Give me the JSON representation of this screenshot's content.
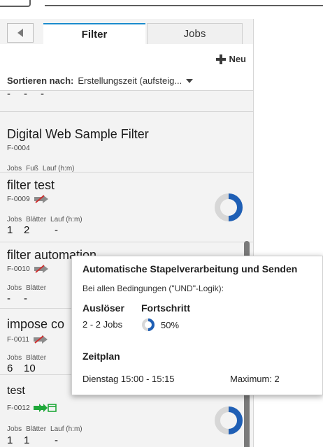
{
  "tabs": {
    "filter": "Filter",
    "jobs": "Jobs"
  },
  "toolbar": {
    "new_label": "Neu",
    "sort_label": "Sortieren nach:",
    "sort_value": "Erstellungszeit (aufsteig..."
  },
  "prev_card": {
    "values": [
      "-",
      "-",
      "-"
    ]
  },
  "cards": [
    {
      "title": "Digital Web Sample Filter",
      "id": "F-0004",
      "headers": [
        "Jobs",
        "Fuß",
        "Lauf (h:m)"
      ],
      "values": [
        "-",
        "-",
        "-"
      ]
    },
    {
      "title": "filter test",
      "id": "F-0009",
      "headers": [
        "Jobs",
        "Blätter",
        "Lauf (h:m)"
      ],
      "values": [
        "1",
        "2",
        "-"
      ],
      "progress": 0.5
    },
    {
      "title": "filter automation",
      "id": "F-0010",
      "headers": [
        "Jobs",
        "Blätter"
      ],
      "values": [
        "-",
        "-"
      ]
    },
    {
      "title": "impose co",
      "id": "F-0011",
      "headers": [
        "Jobs",
        "Blätter"
      ],
      "values": [
        "6",
        "10"
      ]
    },
    {
      "title": "test",
      "id": "F-0012",
      "headers": [
        "Jobs",
        "Blätter",
        "Lauf (h:m)"
      ],
      "values": [
        "1",
        "1",
        "-"
      ],
      "progress": 0.5
    }
  ],
  "tooltip": {
    "title": "Automatische Stapelverarbeitung und Senden",
    "subtitle": "Bei allen Bedingungen (\"UND\"-Logik):",
    "trigger_label": "Auslöser",
    "trigger_value": "2 - 2 Jobs",
    "progress_label": "Fortschritt",
    "progress_value": "50%",
    "progress_fraction": 0.5,
    "schedule_label": "Zeitplan",
    "schedule_value": "Dienstag 15:00 - 15:15",
    "maximum_value": "Maximum: 2"
  },
  "colors": {
    "accent": "#1c8ccd",
    "progress_blue": "#1f5fb5",
    "icon_green": "#1fa83a",
    "icon_red": "#d12b2b"
  },
  "icons": {
    "disabled": "automation-disabled-icon",
    "enabled": "automation-enabled-icon"
  }
}
